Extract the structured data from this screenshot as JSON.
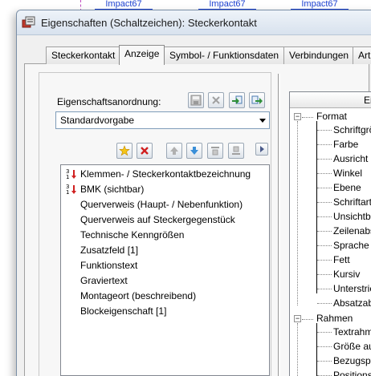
{
  "background": {
    "tabs": [
      "Impact67",
      "Impact67",
      "Impact67"
    ]
  },
  "window": {
    "title": "Eigenschaften (Schaltzeichen): Steckerkontakt"
  },
  "tabs": [
    {
      "label": "Steckerkontakt",
      "active": false
    },
    {
      "label": "Anzeige",
      "active": true
    },
    {
      "label": "Symbol- / Funktionsdaten",
      "active": false
    },
    {
      "label": "Verbindungen",
      "active": false
    },
    {
      "label": "Art",
      "active": false
    }
  ],
  "anzeige": {
    "arrangement_label": "Eigenschaftsanordnung:",
    "arrangement_value": "Standardvorgabe",
    "properties": [
      {
        "label": "Klemmen- / Steckerkontaktbezeichnung",
        "marked": true
      },
      {
        "label": "BMK (sichtbar)",
        "marked": true
      },
      {
        "label": "Querverweis (Haupt- / Nebenfunktion)",
        "marked": false
      },
      {
        "label": "Querverweis auf Steckergegenstück",
        "marked": false
      },
      {
        "label": "Technische Kenngrößen",
        "marked": false
      },
      {
        "label": "Zusatzfeld [1]",
        "marked": false
      },
      {
        "label": "Funktionstext",
        "marked": false
      },
      {
        "label": "Graviertext",
        "marked": false
      },
      {
        "label": "Montageort (beschreibend)",
        "marked": false
      },
      {
        "label": "Blockeigenschaft [1]",
        "marked": false
      }
    ]
  },
  "tree": {
    "header": "Ei",
    "groups": [
      {
        "label": "Format",
        "children": [
          "Schriftgrö",
          "Farbe",
          "Ausricht",
          "Winkel",
          "Ebene",
          "Schriftart",
          "Unsichtb",
          "Zeilenabs",
          "Sprache",
          "Fett",
          "Kursiv",
          "Unterstric",
          "Absatzab"
        ]
      },
      {
        "label": "Rahmen",
        "children": [
          "Textrahm",
          "Größe au",
          "Bezugspf",
          "Positions"
        ]
      }
    ]
  },
  "colors": {
    "accent_blue": "#1a3fd0",
    "marker_red": "#d02020"
  }
}
